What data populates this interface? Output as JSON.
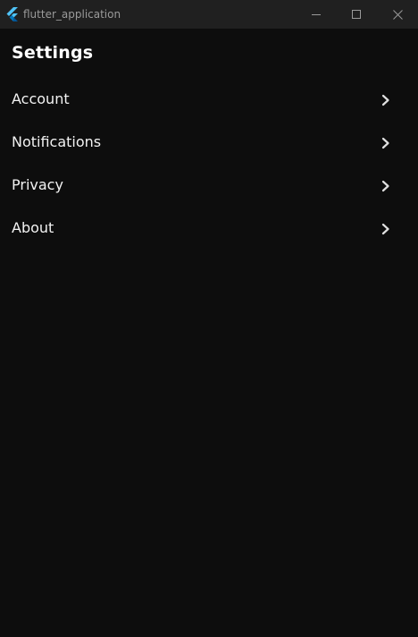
{
  "window": {
    "title": "flutter_application",
    "icons": {
      "app": "flutter-logo-icon",
      "minimize": "minimize-icon",
      "maximize": "maximize-icon",
      "close": "close-icon"
    }
  },
  "colors": {
    "background": "#0d0d0d",
    "titlebar": "#202020",
    "text": "#f2f2f2",
    "flutter_blue": "#4fc3f7"
  },
  "settings": {
    "title": "Settings",
    "items": [
      {
        "label": "Account",
        "icon": "chevron-right-icon"
      },
      {
        "label": "Notifications",
        "icon": "chevron-right-icon"
      },
      {
        "label": "Privacy",
        "icon": "chevron-right-icon"
      },
      {
        "label": "About",
        "icon": "chevron-right-icon"
      }
    ]
  }
}
